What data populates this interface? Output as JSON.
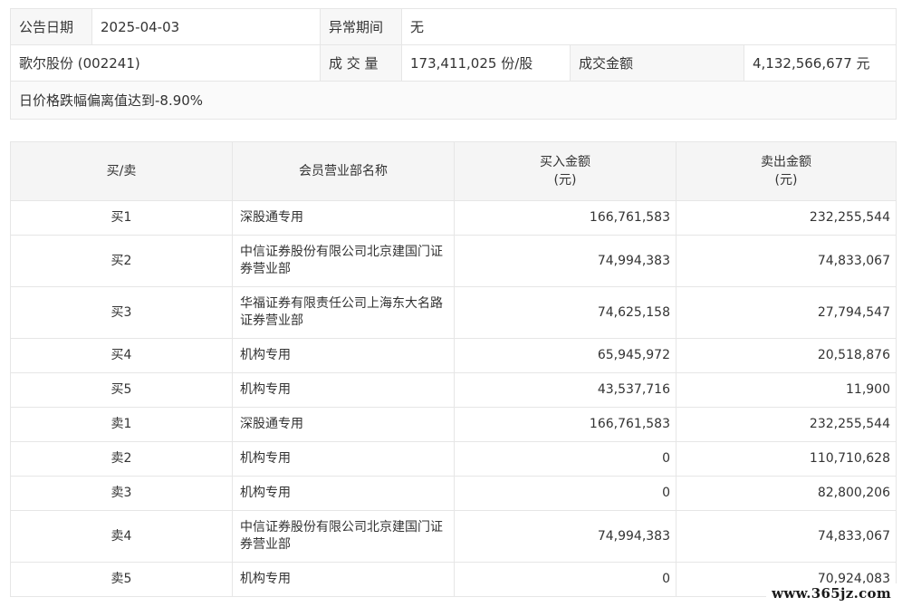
{
  "info": {
    "announce_date_label": "公告日期",
    "announce_date_value": "2025-04-03",
    "abnormal_period_label": "异常期间",
    "abnormal_period_value": "无",
    "stock": "歌尔股份 (002241)",
    "volume_label": "成 交 量",
    "volume_value": "173,411,025 份/股",
    "turnover_label": "成交金额",
    "turnover_value": "4,132,566,677 元",
    "reason": "日价格跌幅偏离值达到-8.90%"
  },
  "table": {
    "headers": {
      "side": "买/卖",
      "dept": "会员营业部名称",
      "buy_line1": "买入金额",
      "buy_line2": "(元)",
      "sell_line1": "卖出金额",
      "sell_line2": "(元)"
    },
    "rows": [
      {
        "side": "买1",
        "dept": "深股通专用",
        "buy": "166,761,583",
        "sell": "232,255,544"
      },
      {
        "side": "买2",
        "dept": "中信证券股份有限公司北京建国门证券营业部",
        "buy": "74,994,383",
        "sell": "74,833,067"
      },
      {
        "side": "买3",
        "dept": "华福证券有限责任公司上海东大名路证券营业部",
        "buy": "74,625,158",
        "sell": "27,794,547"
      },
      {
        "side": "买4",
        "dept": "机构专用",
        "buy": "65,945,972",
        "sell": "20,518,876"
      },
      {
        "side": "买5",
        "dept": "机构专用",
        "buy": "43,537,716",
        "sell": "11,900"
      },
      {
        "side": "卖1",
        "dept": "深股通专用",
        "buy": "166,761,583",
        "sell": "232,255,544"
      },
      {
        "side": "卖2",
        "dept": "机构专用",
        "buy": "0",
        "sell": "110,710,628"
      },
      {
        "side": "卖3",
        "dept": "机构专用",
        "buy": "0",
        "sell": "82,800,206"
      },
      {
        "side": "卖4",
        "dept": "中信证券股份有限公司北京建国门证券营业部",
        "buy": "74,994,383",
        "sell": "74,833,067"
      },
      {
        "side": "卖5",
        "dept": "机构专用",
        "buy": "0",
        "sell": "70,924,083"
      }
    ]
  },
  "watermark": "www.365jz.com"
}
